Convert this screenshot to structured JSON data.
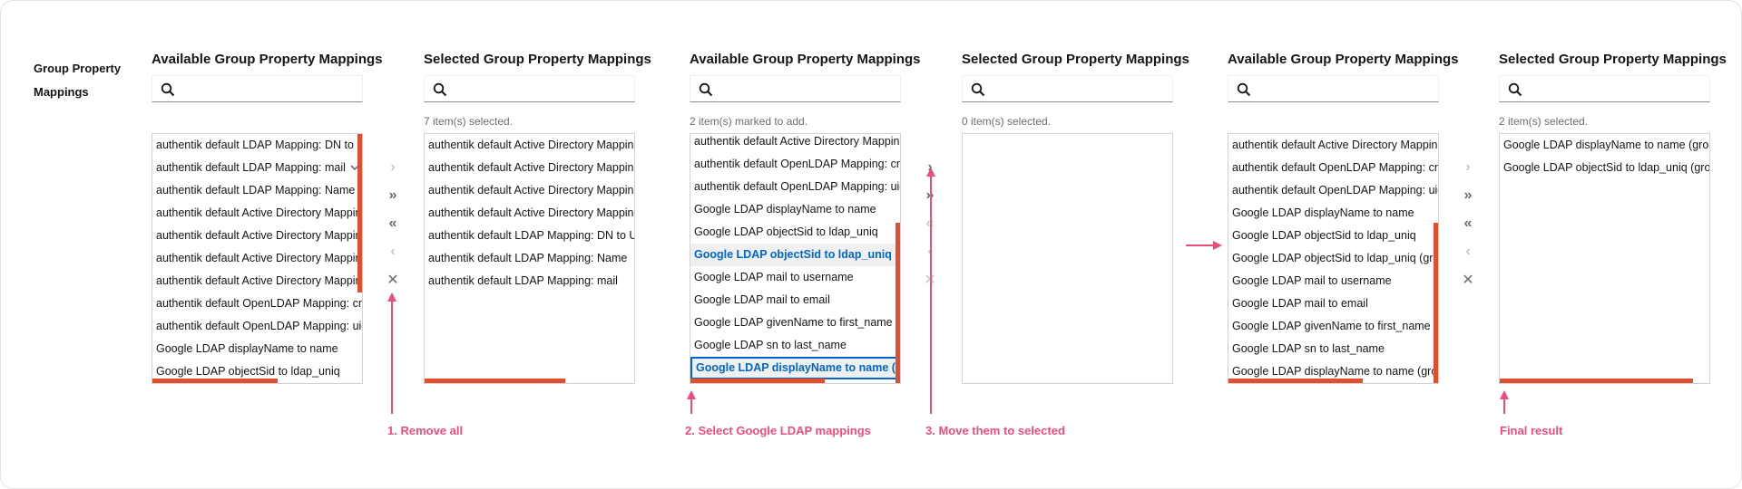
{
  "field_label": "Group Property Mappings",
  "search_placeholder": "",
  "step1": {
    "available_title": "Available Group Property Mappings",
    "available_items": [
      "authentik default LDAP Mapping: DN to User Path",
      "authentik default LDAP Mapping: mail",
      "authentik default LDAP Mapping: Name",
      "authentik default Active Directory Mapping: givenName",
      "authentik default Active Directory Mapping: sAMAccountName",
      "authentik default Active Directory Mapping: sn",
      "authentik default Active Directory Mapping: userPrincipalName",
      "authentik default OpenLDAP Mapping: cn",
      "authentik default OpenLDAP Mapping: uid",
      "Google LDAP displayName to name",
      "Google LDAP objectSid to ldap_uniq"
    ],
    "selected_title": "Selected Group Property Mappings",
    "selected_status": "7 item(s) selected.",
    "selected_items": [
      "authentik default Active Directory Mapping: givenName",
      "authentik default Active Directory Mapping: sAMAccountName",
      "authentik default Active Directory Mapping: sn",
      "authentik default Active Directory Mapping: userPrincipalName",
      "authentik default LDAP Mapping: DN to User Path",
      "authentik default LDAP Mapping: Name",
      "authentik default LDAP Mapping: mail"
    ],
    "annotation": "1. Remove all"
  },
  "step2": {
    "available_title": "Available Group Property Mappings",
    "available_status": "2 item(s) marked to add.",
    "available_items": [
      "authentik default Active Directory Mapping: givenName",
      "authentik default OpenLDAP Mapping: cn",
      "authentik default OpenLDAP Mapping: uid",
      "Google LDAP displayName to name",
      "Google LDAP objectSid to ldap_uniq",
      "Google LDAP objectSid to ldap_uniq (group)",
      "Google LDAP mail to username",
      "Google LDAP mail to email",
      "Google LDAP givenName to first_name",
      "Google LDAP sn to last_name",
      "Google LDAP displayName to name (group)"
    ],
    "annotation": "2. Select Google LDAP mappings"
  },
  "step3": {
    "selected_title": "Selected Group Property Mappings",
    "selected_status": "0 item(s) selected.",
    "annotation": "3. Move them to selected"
  },
  "step4": {
    "available_title": "Available Group Property Mappings",
    "available_items": [
      "authentik default Active Directory Mapping: givenName",
      "authentik default OpenLDAP Mapping: cn",
      "authentik default OpenLDAP Mapping: uid",
      "Google LDAP displayName to name",
      "Google LDAP objectSid to ldap_uniq",
      "Google LDAP objectSid to ldap_uniq (group)",
      "Google LDAP mail to username",
      "Google LDAP mail to email",
      "Google LDAP givenName to first_name",
      "Google LDAP sn to last_name",
      "Google LDAP displayName to name (group)"
    ],
    "selected_title": "Selected Group Property Mappings",
    "selected_status": "2 item(s) selected.",
    "selected_items": [
      "Google LDAP displayName to name (group)",
      "Google LDAP objectSid to ldap_uniq (group)"
    ],
    "annotation": "Final result"
  },
  "controls": {
    "add_selected": "›",
    "add_all": "»",
    "remove_all": "«",
    "remove_selected": "‹",
    "clear": "✕"
  },
  "colors": {
    "annotation": "#ee4d7b",
    "scrollbar": "#e0502f",
    "selected_text": "#0066cc"
  }
}
